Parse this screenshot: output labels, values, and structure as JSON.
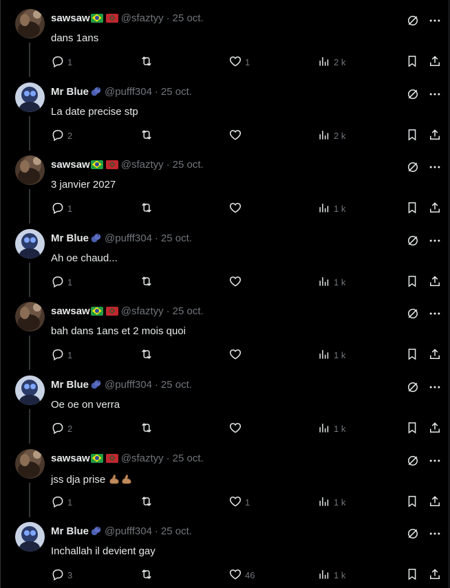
{
  "tweets": [
    {
      "author": "sawsaw",
      "flags": [
        "brazil-flag",
        "morocco-flag"
      ],
      "handle": "@sfaztyy",
      "date": "25 oct.",
      "text": "dans 1ans",
      "replies": "1",
      "likes": "1",
      "views": "2 k",
      "avatar": "brown"
    },
    {
      "author": "Mr Blue",
      "flags": [
        "blueberry"
      ],
      "handle": "@pufff304",
      "date": "25 oct.",
      "text": "La date precise stp",
      "replies": "2",
      "likes": "",
      "views": "2 k",
      "avatar": "blue"
    },
    {
      "author": "sawsaw",
      "flags": [
        "brazil-flag",
        "morocco-flag"
      ],
      "handle": "@sfaztyy",
      "date": "25 oct.",
      "text": "3 janvier 2027",
      "replies": "1",
      "likes": "",
      "views": "1 k",
      "avatar": "brown"
    },
    {
      "author": "Mr Blue",
      "flags": [
        "blueberry"
      ],
      "handle": "@pufff304",
      "date": "25 oct.",
      "text": "Ah oe chaud...",
      "replies": "1",
      "likes": "",
      "views": "1 k",
      "avatar": "blue"
    },
    {
      "author": "sawsaw",
      "flags": [
        "brazil-flag",
        "morocco-flag"
      ],
      "handle": "@sfaztyy",
      "date": "25 oct.",
      "text": "bah dans 1ans et 2 mois quoi",
      "replies": "1",
      "likes": "",
      "views": "1 k",
      "avatar": "brown"
    },
    {
      "author": "Mr Blue",
      "flags": [
        "blueberry"
      ],
      "handle": "@pufff304",
      "date": "25 oct.",
      "text": "Oe oe on verra",
      "replies": "2",
      "likes": "",
      "views": "1 k",
      "avatar": "blue"
    },
    {
      "author": "sawsaw",
      "flags": [
        "brazil-flag",
        "morocco-flag"
      ],
      "handle": "@sfaztyy",
      "date": "25 oct.",
      "text": "jss dja prise",
      "text_emoji": "flexed-biceps x2",
      "replies": "1",
      "likes": "1",
      "views": "1 k",
      "avatar": "brown"
    },
    {
      "author": "Mr Blue",
      "flags": [
        "blueberry"
      ],
      "handle": "@pufff304",
      "date": "25 oct.",
      "text": "Inchallah il devient gay",
      "replies": "3",
      "likes": "46",
      "views": "1 k",
      "avatar": "blue"
    }
  ],
  "icons": {
    "reply": "speech-bubble-icon",
    "retweet": "retweet-icon",
    "like": "heart-icon",
    "views": "bar-chart-icon",
    "bookmark": "bookmark-icon",
    "share": "share-icon",
    "grok": "slashed-circle-icon",
    "more": "more-dots-icon"
  },
  "colors": {
    "background": "#000000",
    "text": "#e7e9ea",
    "muted": "#71767b",
    "line": "#333639"
  }
}
